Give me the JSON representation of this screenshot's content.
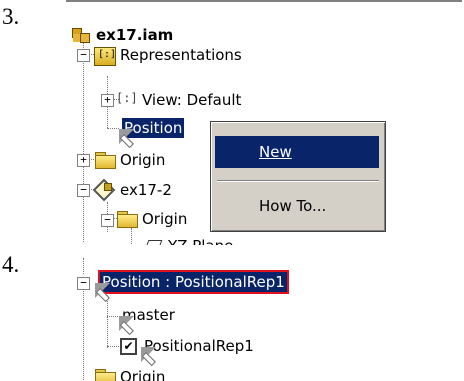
{
  "steps": {
    "step3": "3.",
    "step4": "4."
  },
  "top_tree": {
    "root_label": "ex17.iam",
    "representations_label": "Representations",
    "view_label": "View: Default",
    "position_label": "Position",
    "origin_label": "Origin",
    "part_label": "ex17-2",
    "origin_child_label": "Origin",
    "plane_label": "YZ Plane"
  },
  "context_menu": {
    "items": [
      {
        "label": "New",
        "mnemonic": "N",
        "highlighted": true
      },
      {
        "label": "How To...",
        "mnemonic": "H",
        "highlighted": false
      }
    ]
  },
  "bottom_tree": {
    "position_label": "Position : PositionalRep1",
    "master_label": "master",
    "rep1_label": "PositionalRep1",
    "rep1_checked": "✔",
    "origin_label": "Origin"
  },
  "colors": {
    "selection": "#0a246a",
    "highlight_border": "#e0101e",
    "menu_bg": "#d4d0c8"
  }
}
